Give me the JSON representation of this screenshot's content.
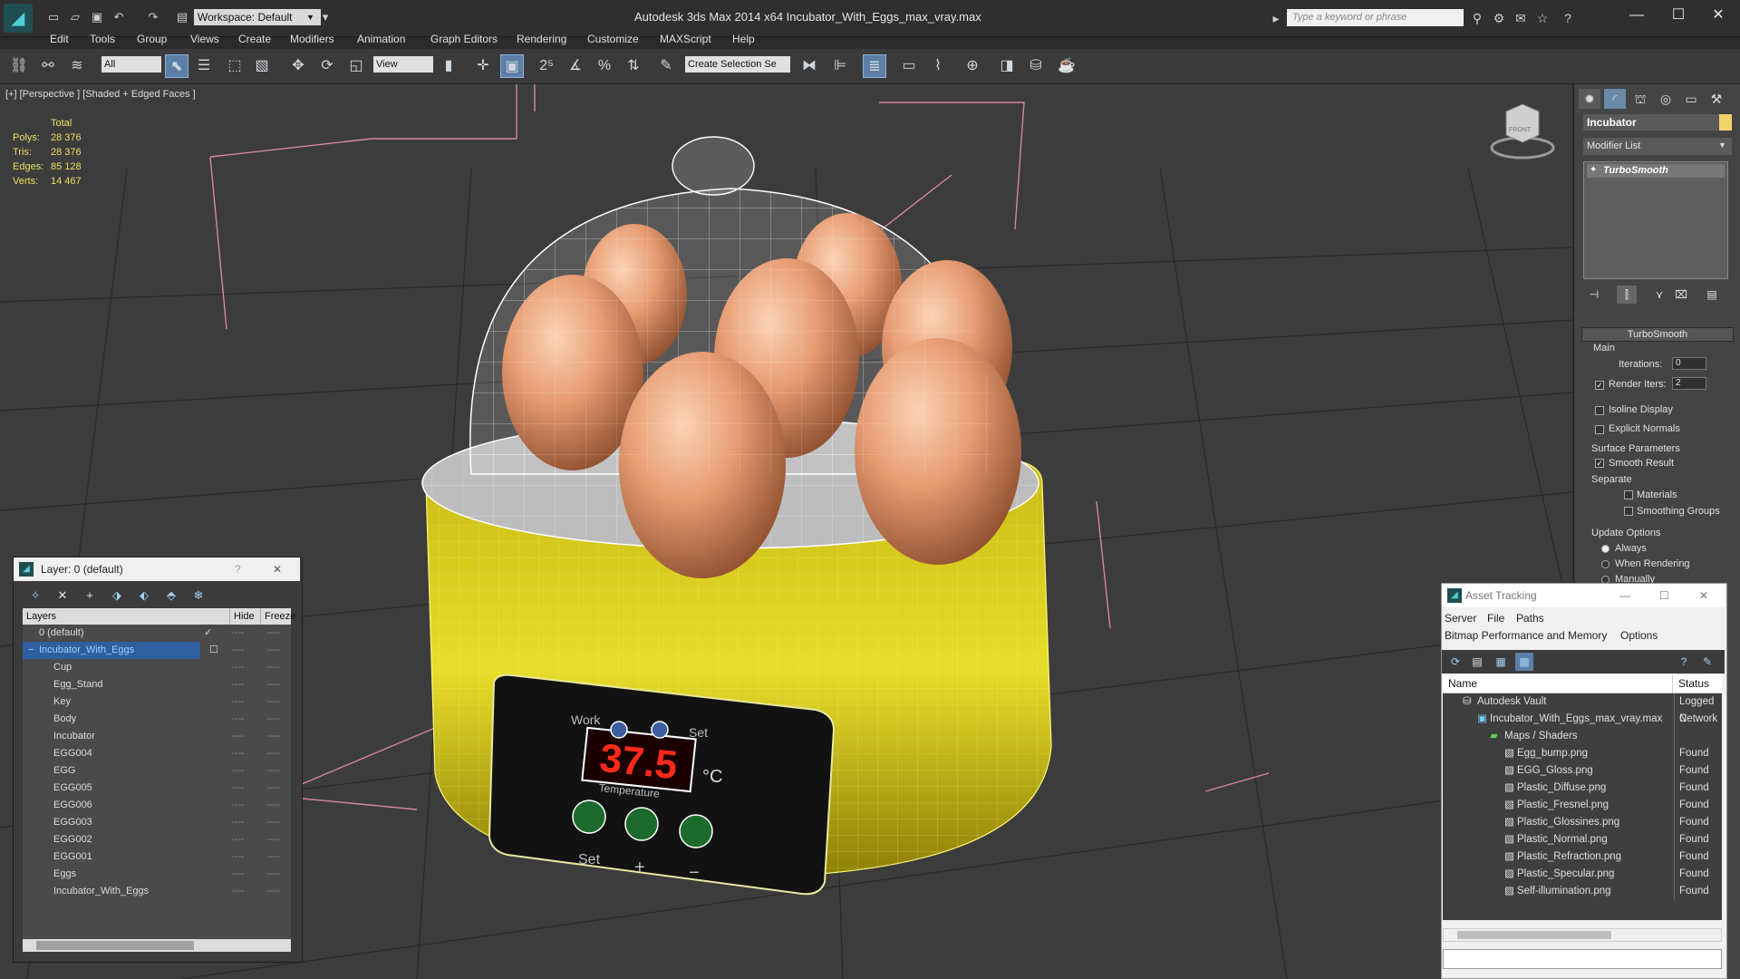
{
  "titlebar": {
    "workspace": "Workspace: Default",
    "title": "Autodesk 3ds Max  2014 x64      Incubator_With_Eggs_max_vray.max",
    "search_placeholder": "Type a keyword or phrase",
    "minimize": "—",
    "maximize": "☐",
    "close": "✕"
  },
  "menu": [
    "Edit",
    "Tools",
    "Group",
    "Views",
    "Create",
    "Modifiers",
    "Animation",
    "Graph Editors",
    "Rendering",
    "Customize",
    "MAXScript",
    "Help"
  ],
  "toolbar": {
    "selection_filter": "All",
    "ref_coord": "View",
    "snap_value": "2.5",
    "named_selection": "Create Selection Se"
  },
  "viewport": {
    "label": "[+] [Perspective ] [Shaded + Edged Faces ]",
    "stats_header": "Total",
    "stats": [
      {
        "key": "Polys:",
        "value": "28 376"
      },
      {
        "key": "Tris:",
        "value": "28 376"
      },
      {
        "key": "Edges:",
        "value": "85 128"
      },
      {
        "key": "Verts:",
        "value": "14 467"
      }
    ],
    "display_temp": "37.5",
    "display_unit": "°C",
    "panel_labels": [
      "Work",
      "Set",
      "Temperature",
      "Set",
      "+",
      "−"
    ],
    "viewcube_label": "FRONT"
  },
  "command_panel": {
    "object_name": "Incubator",
    "object_color": "#f2d46a",
    "modifier_list": "Modifier List",
    "stack_item": "TurboSmooth",
    "rollout_title": "TurboSmooth",
    "main_label": "Main",
    "iterations_label": "Iterations:",
    "iterations_value": "0",
    "render_iters_label": "Render Iters:",
    "render_iters_value": "2",
    "isoline": "Isoline Display",
    "explicit_normals": "Explicit Normals",
    "surface_params": "Surface Parameters",
    "smooth_result": "Smooth Result",
    "separate": "Separate",
    "materials": "Materials",
    "smoothing_groups": "Smoothing Groups",
    "update_options": "Update Options",
    "always": "Always",
    "when_rendering": "When Rendering",
    "manually": "Manually"
  },
  "layer_dialog": {
    "title": "Layer: 0 (default)",
    "help": "?",
    "close": "✕",
    "col_layers": "Layers",
    "col_hide": "Hide",
    "col_freeze": "Freeze",
    "rows": [
      {
        "name": "0 (default)"
      },
      {
        "name": "Incubator_With_Eggs"
      },
      {
        "name": "Cup"
      },
      {
        "name": "Egg_Stand"
      },
      {
        "name": "Key"
      },
      {
        "name": "Body"
      },
      {
        "name": "Incubator"
      },
      {
        "name": "EGG004"
      },
      {
        "name": "EGG"
      },
      {
        "name": "EGG005"
      },
      {
        "name": "EGG006"
      },
      {
        "name": "EGG003"
      },
      {
        "name": "EGG002"
      },
      {
        "name": "EGG001"
      },
      {
        "name": "Eggs"
      },
      {
        "name": "Incubator_With_Eggs"
      }
    ]
  },
  "asset_tracking": {
    "title": "Asset Tracking",
    "menu1": [
      "Server",
      "File",
      "Paths"
    ],
    "menu2": [
      "Bitmap Performance and Memory",
      "Options"
    ],
    "col_name": "Name",
    "col_status": "Status",
    "rows": [
      {
        "name": "Autodesk Vault",
        "status": "Logged C"
      },
      {
        "name": "Incubator_With_Eggs_max_vray.max",
        "status": "Network"
      },
      {
        "name": "Maps / Shaders",
        "status": ""
      },
      {
        "name": "Egg_bump.png",
        "status": "Found"
      },
      {
        "name": "EGG_Gloss.png",
        "status": "Found"
      },
      {
        "name": "Plastic_Diffuse.png",
        "status": "Found"
      },
      {
        "name": "Plastic_Fresnel.png",
        "status": "Found"
      },
      {
        "name": "Plastic_Glossines.png",
        "status": "Found"
      },
      {
        "name": "Plastic_Normal.png",
        "status": "Found"
      },
      {
        "name": "Plastic_Refraction.png",
        "status": "Found"
      },
      {
        "name": "Plastic_Specular.png",
        "status": "Found"
      },
      {
        "name": "Self-illumination.png",
        "status": "Found"
      }
    ]
  }
}
